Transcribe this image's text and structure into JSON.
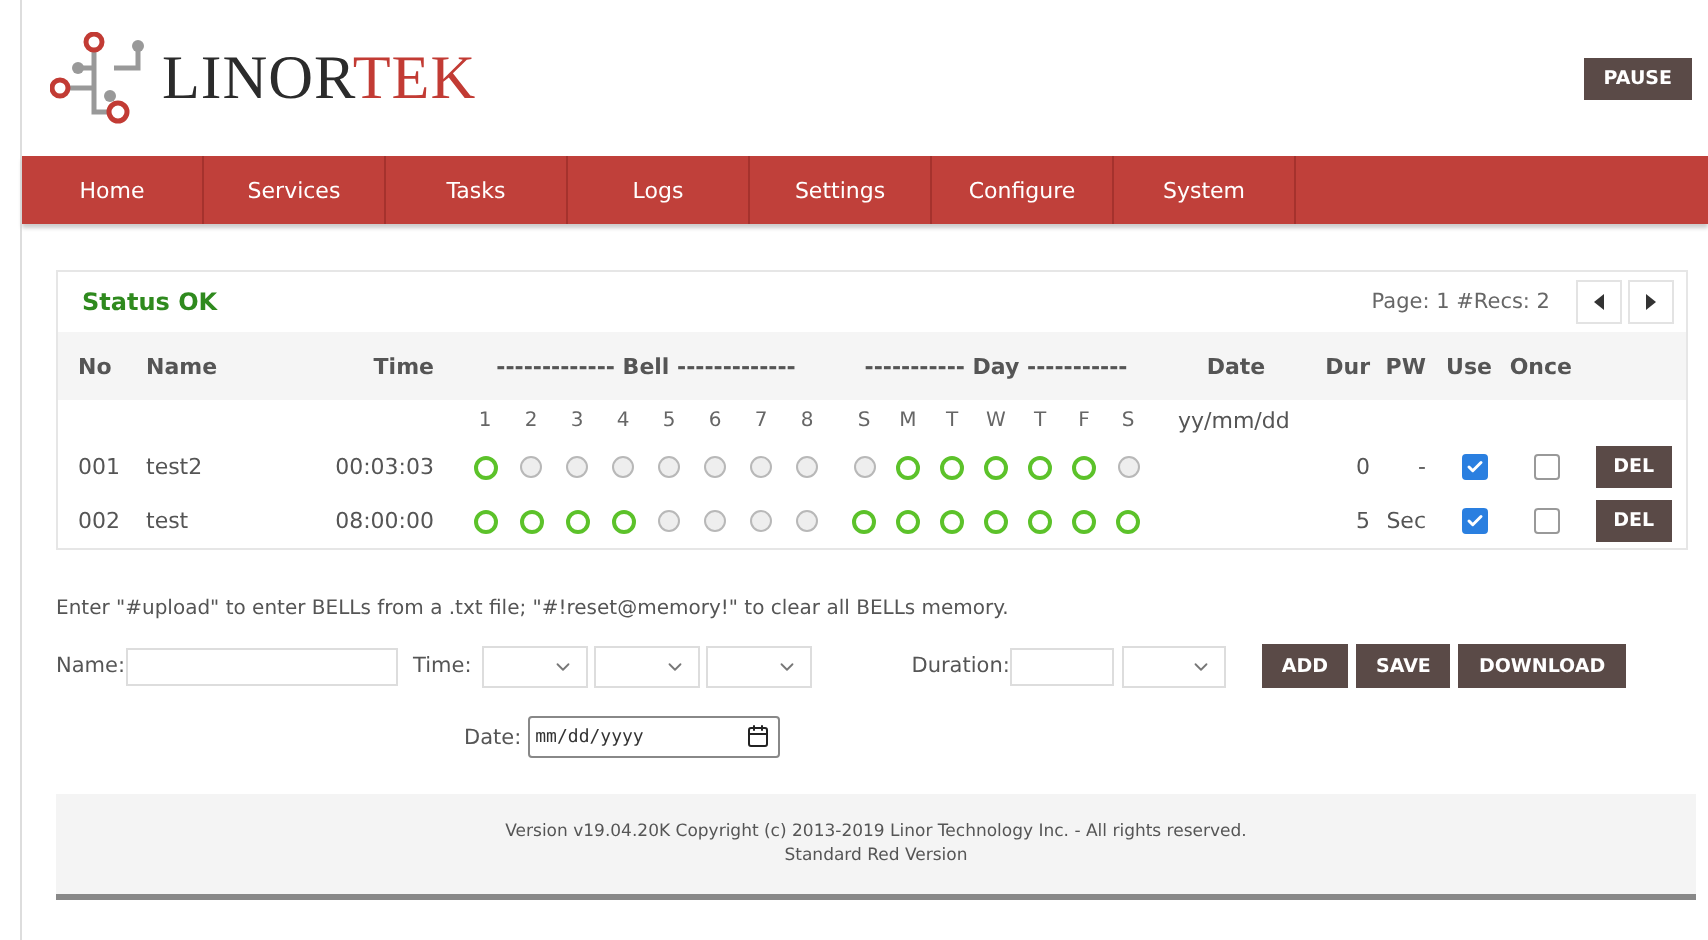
{
  "header": {
    "logo": {
      "text_1": "LINOR",
      "text_2": "TEK"
    },
    "pause_button": "PAUSE"
  },
  "nav": [
    {
      "label": "Home"
    },
    {
      "label": "Services"
    },
    {
      "label": "Tasks"
    },
    {
      "label": "Logs"
    },
    {
      "label": "Settings"
    },
    {
      "label": "Configure"
    },
    {
      "label": "System"
    }
  ],
  "panel": {
    "status": "Status OK",
    "paging": "Page: 1 #Recs: 2",
    "columns": [
      "No",
      "Name",
      "Time",
      "------------- Bell -------------",
      "----------- Day -----------",
      "Date",
      "Dur",
      "PW",
      "Use",
      "Once"
    ],
    "bell_numbers": [
      "1",
      "2",
      "3",
      "4",
      "5",
      "6",
      "7",
      "8"
    ],
    "day_letters": [
      "S",
      "M",
      "T",
      "W",
      "T",
      "F",
      "S"
    ],
    "date_format": "yy/mm/dd",
    "rows": [
      {
        "no": "001",
        "name": "test2",
        "time": "00:03:03",
        "bells": [
          {
            "on": true
          },
          {
            "on": false
          },
          {
            "on": false
          },
          {
            "on": false
          },
          {
            "on": false
          },
          {
            "on": false
          },
          {
            "on": false
          },
          {
            "on": false
          }
        ],
        "days": [
          {
            "on": false
          },
          {
            "on": true
          },
          {
            "on": true
          },
          {
            "on": true
          },
          {
            "on": true
          },
          {
            "on": true
          },
          {
            "on": false
          }
        ],
        "dur": "0",
        "pw": "-",
        "use": true,
        "once": false,
        "delete": "DEL"
      },
      {
        "no": "002",
        "name": "test",
        "time": "08:00:00",
        "bells": [
          {
            "on": true
          },
          {
            "on": true
          },
          {
            "on": true
          },
          {
            "on": true
          },
          {
            "on": false
          },
          {
            "on": false
          },
          {
            "on": false
          },
          {
            "on": false
          }
        ],
        "days": [
          {
            "on": true
          },
          {
            "on": true
          },
          {
            "on": true
          },
          {
            "on": true
          },
          {
            "on": true
          },
          {
            "on": true
          },
          {
            "on": true
          }
        ],
        "dur": "5",
        "pw": "Sec",
        "use": true,
        "once": false,
        "delete": "DEL"
      }
    ]
  },
  "hint": "Enter \"#upload\" to enter BELLs from a .txt file; \"#!reset@memory!\" to clear all BELLs memory.",
  "form": {
    "name_label": "Name:",
    "time_label": "Time:",
    "duration_label": "Duration:",
    "date_label": "Date:",
    "date_placeholder": "mm/dd/yyyy",
    "buttons": [
      "ADD",
      "SAVE",
      "DOWNLOAD"
    ]
  },
  "footer": {
    "lines": [
      "Version v19.04.20K Copyright (c) 2013-2019 Linor Technology Inc. - All rights reserved.",
      "Standard Red Version"
    ]
  }
}
